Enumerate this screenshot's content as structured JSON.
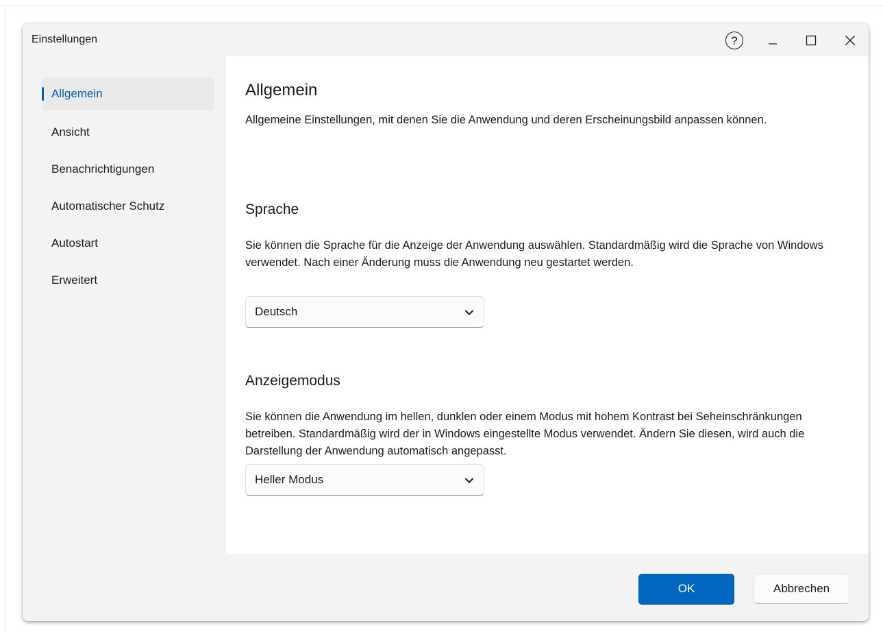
{
  "window": {
    "title": "Einstellungen",
    "help_symbol": "?",
    "controls": [
      "minimize-icon",
      "maximize-icon",
      "close-icon"
    ]
  },
  "sidebar": {
    "items": [
      {
        "label": "Allgemein",
        "active": true
      },
      {
        "label": "Ansicht",
        "active": false
      },
      {
        "label": "Benachrichtigungen",
        "active": false
      },
      {
        "label": "Automatischer Schutz",
        "active": false
      },
      {
        "label": "Autostart",
        "active": false
      },
      {
        "label": "Erweitert",
        "active": false
      }
    ]
  },
  "main": {
    "title": "Allgemein",
    "description": "Allgemeine Einstellungen, mit denen Sie die Anwendung und deren Erscheinungsbild anpassen können.",
    "language": {
      "heading": "Sprache",
      "description": "Sie können die Sprache für die Anzeige der Anwendung auswählen. Standardmäßig wird die Sprache von Windows verwendet. Nach einer Änderung muss die Anwendung neu gestartet werden.",
      "selected": "Deutsch"
    },
    "display_mode": {
      "heading": "Anzeigemodus",
      "description": "Sie können die Anwendung im hellen, dunklen oder einem Modus mit hohem Kontrast bei Seheinschränkungen betreiben. Standardmäßig wird der in Windows eingestellte Modus verwendet. Ändern Sie diesen, wird auch die Darstellung der Anwendung automatisch angepasst.",
      "selected": "Heller Modus"
    }
  },
  "footer": {
    "ok_label": "OK",
    "cancel_label": "Abbrechen"
  },
  "colors": {
    "accent": "#0067c0",
    "nav_active_text": "#005fb8",
    "sidebar_bg": "#f3f3f3",
    "content_bg": "#ffffff"
  }
}
